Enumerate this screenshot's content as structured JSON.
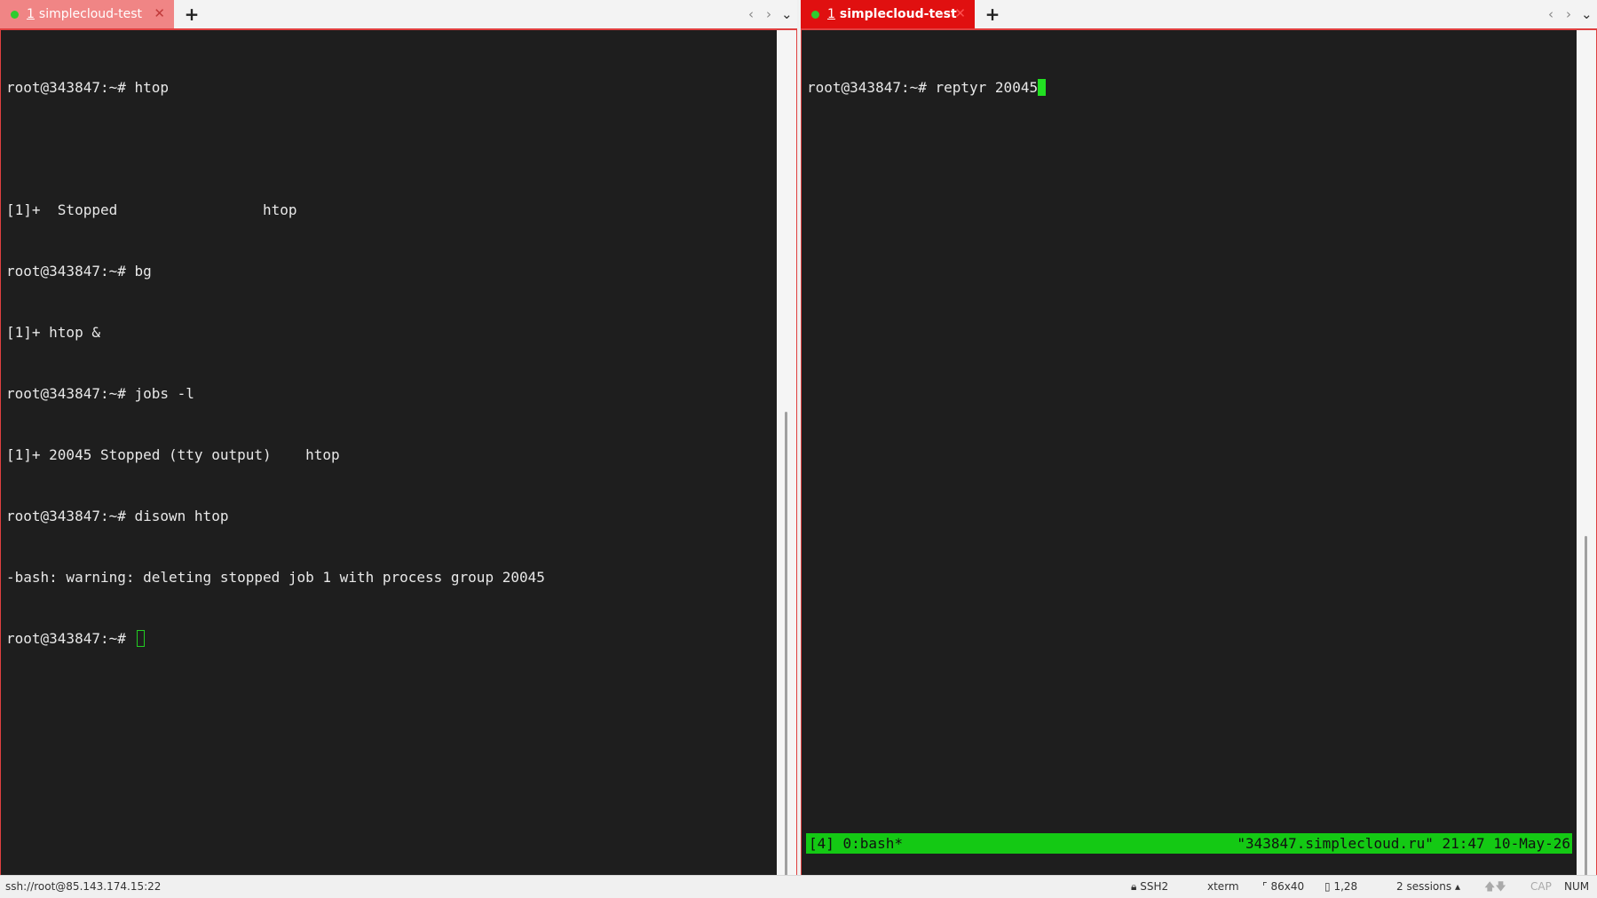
{
  "left_pane": {
    "tab": {
      "number": "1",
      "title": "simplecloud-test"
    },
    "new_tab": "+",
    "lines": [
      "root@343847:~# htop",
      "",
      "[1]+  Stopped                 htop",
      "root@343847:~# bg",
      "[1]+ htop &",
      "root@343847:~# jobs -l",
      "[1]+ 20045 Stopped (tty output)    htop",
      "root@343847:~# disown htop",
      "-bash: warning: deleting stopped job 1 with process group 20045"
    ],
    "prompt": "root@343847:~# "
  },
  "right_pane": {
    "tab": {
      "number": "1",
      "title": "simplecloud-test"
    },
    "new_tab": "+",
    "command_line": "root@343847:~# reptyr 20045",
    "tmux_status": {
      "left": "[4] 0:bash*",
      "right": "\"343847.simplecloud.ru\" 21:47 10-May-26"
    }
  },
  "status_bar": {
    "connection": "ssh://root@85.143.174.15:22",
    "protocol": "SSH2",
    "terminal_type": "xterm",
    "size": "86x40",
    "cursor_pos": "1,28",
    "sessions": "2 sessions",
    "cap": "CAP",
    "num": "NUM"
  },
  "colors": {
    "active_tab": "#e01010",
    "inactive_tab": "#f08585",
    "terminal_bg": "#1e1e1e",
    "tmux_bar": "#14c914",
    "cursor": "#22cc22"
  }
}
